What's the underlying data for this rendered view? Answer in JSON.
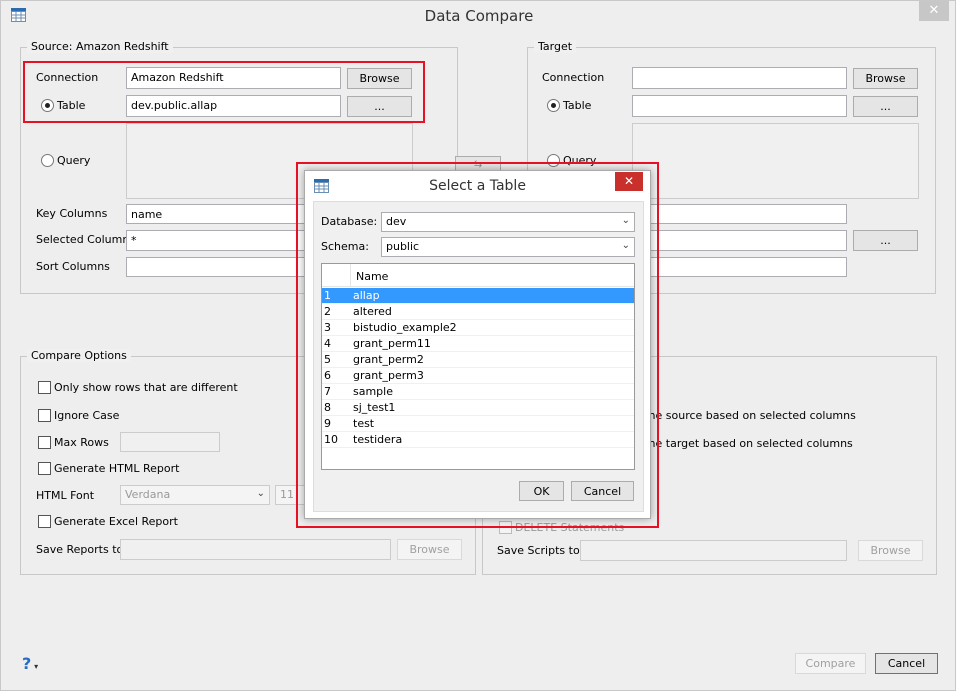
{
  "window": {
    "title": "Data Compare",
    "close_icon": "close-icon"
  },
  "source": {
    "legend": "Source: Amazon Redshift",
    "connection_label": "Connection",
    "connection_value": "Amazon Redshift",
    "browse": "Browse",
    "table_label": "Table",
    "table_value": "dev.public.allap",
    "table_btn": "...",
    "table_selected": true,
    "query_label": "Query",
    "key_label": "Key Columns",
    "key_value": "name",
    "selected_label": "Selected Columns",
    "selected_value": "*",
    "sort_label": "Sort Columns",
    "sort_value": ""
  },
  "target": {
    "legend": "Target",
    "connection_label": "Connection",
    "connection_value": "",
    "browse": "Browse",
    "table_label": "Table",
    "table_value": "",
    "table_btn": "...",
    "table_selected": true,
    "query_label": "Query",
    "selected_btn": "..."
  },
  "compare_options": {
    "legend": "Compare Options",
    "only_diff": "Only show rows that are different",
    "ignore_case": "Ignore Case",
    "max_rows": "Max Rows",
    "gen_html": "Generate HTML Report",
    "html_font_label": "HTML Font",
    "html_font": "Verdana",
    "html_font_size": "11",
    "gen_excel": "Generate Excel Report",
    "save_reports_label": "Save Reports to",
    "browse": "Browse"
  },
  "scripts": {
    "source_text": "s the source based on selected columns",
    "target_text": "s the target based on selected columns",
    "delete_label": "DELETE Statements",
    "save_scripts_label": "Save Scripts to",
    "browse": "Browse"
  },
  "footer": {
    "help": "?",
    "compare": "Compare",
    "cancel": "Cancel"
  },
  "dialog": {
    "title": "Select a Table",
    "database_label": "Database:",
    "database": "dev",
    "schema_label": "Schema:",
    "schema": "public",
    "column_header": "Name",
    "rows": [
      {
        "n": "1",
        "name": "allap",
        "selected": true
      },
      {
        "n": "2",
        "name": "altered"
      },
      {
        "n": "3",
        "name": "bistudio_example2"
      },
      {
        "n": "4",
        "name": "grant_perm11"
      },
      {
        "n": "5",
        "name": "grant_perm2"
      },
      {
        "n": "6",
        "name": "grant_perm3"
      },
      {
        "n": "7",
        "name": "sample"
      },
      {
        "n": "8",
        "name": "sj_test1"
      },
      {
        "n": "9",
        "name": "test"
      },
      {
        "n": "10",
        "name": "testidera"
      }
    ],
    "ok": "OK",
    "cancel": "Cancel"
  },
  "colors": {
    "selection": "#3399ff",
    "highlight": "#e81123",
    "close": "#c9302c"
  }
}
